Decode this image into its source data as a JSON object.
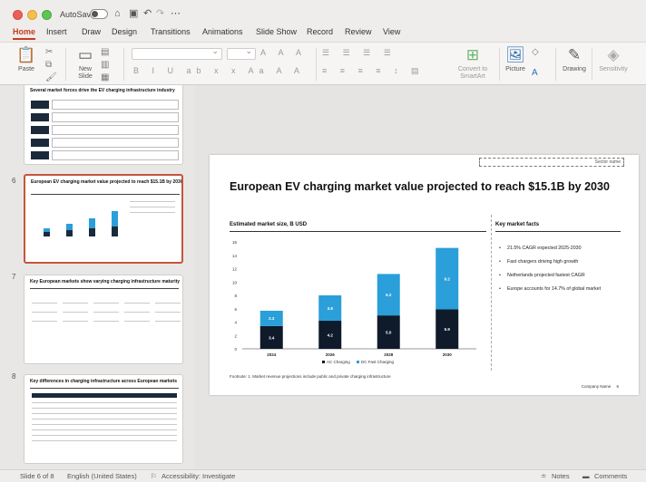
{
  "titlebar": {
    "autosave_label": "AutoSave",
    "icons": [
      "home-icon",
      "save-icon",
      "undo-icon",
      "redo-icon",
      "more-icon"
    ]
  },
  "tabs": [
    "Home",
    "Insert",
    "Draw",
    "Design",
    "Transitions",
    "Animations",
    "Slide Show",
    "Record",
    "Review",
    "View"
  ],
  "ribbon": {
    "paste_label": "Paste",
    "new_slide_label": "New\nSlide",
    "convert_label": "Convert to\nSmartArt",
    "picture_label": "Picture",
    "drawing_label": "Drawing",
    "sensitivity_label": "Sensitivity"
  },
  "thumbnails": [
    {
      "number": "",
      "title": "Several market forces drive the EV charging infrastructure industry"
    },
    {
      "number": "6",
      "title": "European EV charging market value projected to reach $15.1B by 2030",
      "selected": true
    },
    {
      "number": "7",
      "title": "Key European markets show varying charging infrastructure maturity"
    },
    {
      "number": "8",
      "title": "Key differences in charging infrastructure across European markets"
    }
  ],
  "slide": {
    "sector_label": "Sector name",
    "title": "European EV charging market value projected to reach $15.1B by 2030",
    "chart_section_title": "Estimated market size, B USD",
    "facts_section_title": "Key market facts",
    "facts": [
      "21.5% CAGR expected 2025-2030",
      "Fast chargers driving high growth",
      "Netherlands projected fastest CAGR",
      "Europe accounts for 14.7% of global market"
    ],
    "footnote": "Footnote: 1. Market revenue projections include public and private charging infrastructure",
    "company_name": "Company Name",
    "page_number": "6"
  },
  "chart_data": {
    "type": "bar",
    "stacked": true,
    "categories": [
      "2024",
      "2026",
      "2028",
      "2030"
    ],
    "series": [
      {
        "name": "AC Charging",
        "values": [
          3.4,
          4.2,
          5.0,
          5.9
        ],
        "color": "#0f1a2b"
      },
      {
        "name": "DC Fast Charging",
        "values": [
          2.3,
          3.8,
          6.2,
          9.2
        ],
        "color": "#2a9fd9"
      }
    ],
    "yticks": [
      0,
      2,
      4,
      6,
      8,
      10,
      12,
      14,
      16
    ],
    "ylim": [
      0,
      16
    ],
    "grid": false,
    "legend": "bottom"
  },
  "statusbar": {
    "slide_info": "Slide 6 of 8",
    "language": "English (United States)",
    "accessibility": "Accessibility: Investigate",
    "notes": "Notes",
    "comments": "Comments"
  }
}
